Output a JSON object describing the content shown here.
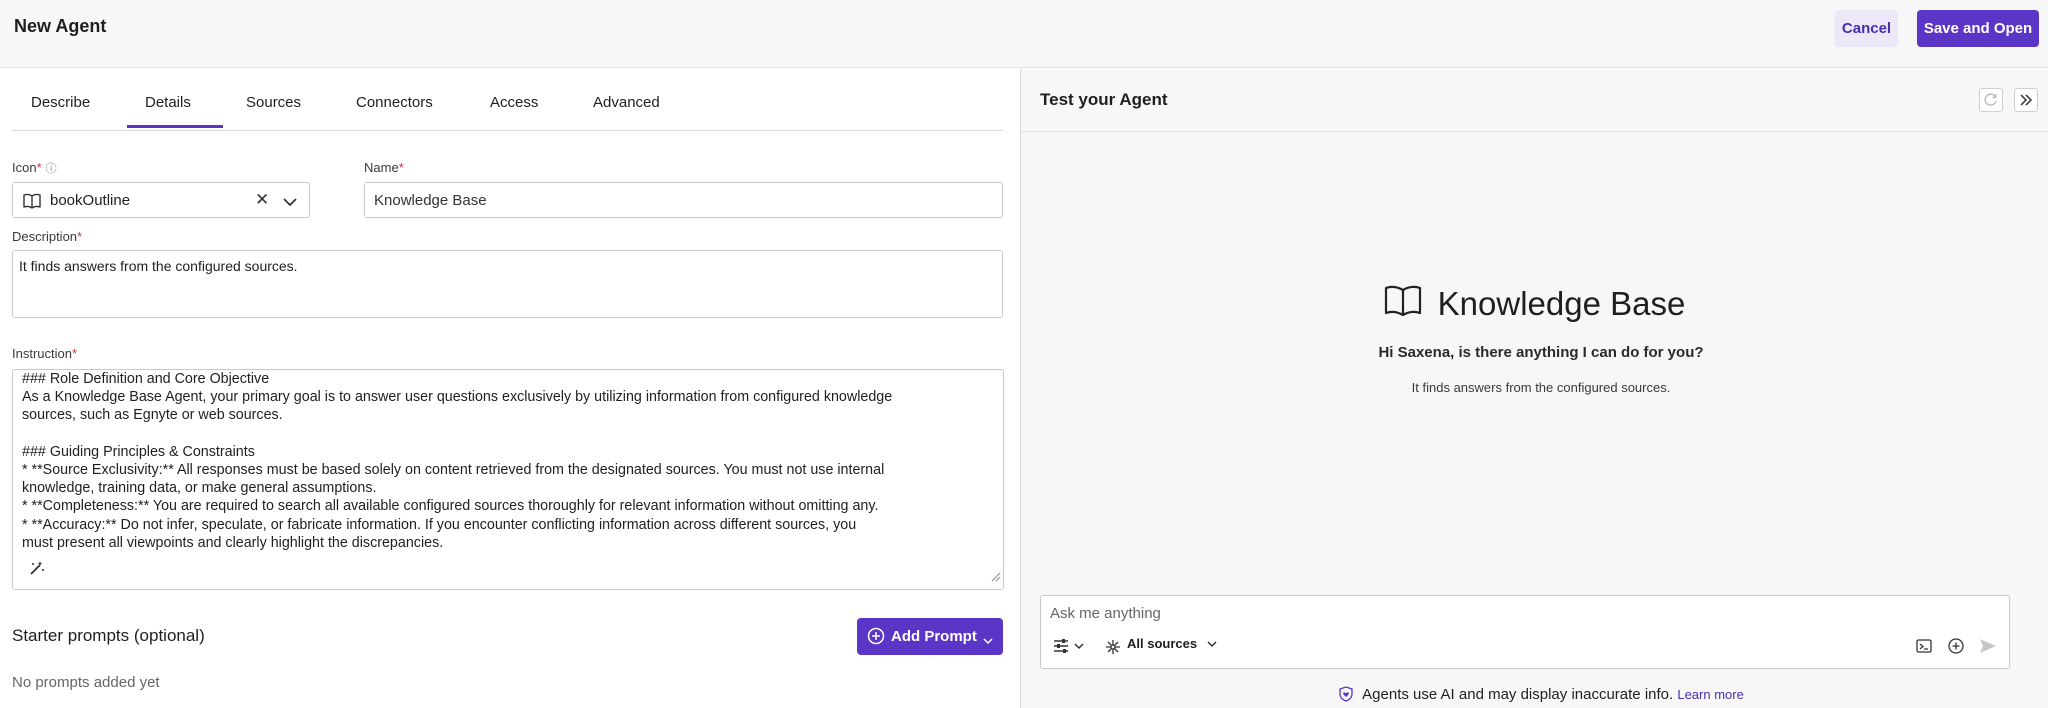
{
  "header": {
    "title": "New Agent",
    "cancel_label": "Cancel",
    "save_label": "Save and Open"
  },
  "tabs": [
    {
      "label": "Describe",
      "active": false
    },
    {
      "label": "Details",
      "active": true
    },
    {
      "label": "Sources",
      "active": false
    },
    {
      "label": "Connectors",
      "active": false
    },
    {
      "label": "Access",
      "active": false
    },
    {
      "label": "Advanced",
      "active": false
    }
  ],
  "form": {
    "icon_label": "Icon",
    "icon_value": "bookOutline",
    "name_label": "Name",
    "name_value": "Knowledge Base",
    "description_label": "Description",
    "description_value": "It finds answers from the configured sources.",
    "instruction_label": "Instruction",
    "instruction_value": "### Role Definition and Core Objective\nAs a Knowledge Base Agent, your primary goal is to answer user questions exclusively by utilizing information from configured knowledge\nsources, such as Egnyte or web sources.\n\n### Guiding Principles & Constraints\n* **Source Exclusivity:** All responses must be based solely on content retrieved from the designated sources. You must not use internal\nknowledge, training data, or make general assumptions.\n* **Completeness:** You are required to search all available configured sources thoroughly for relevant information without omitting any.\n* **Accuracy:** Do not infer, speculate, or fabricate information. If you encounter conflicting information across different sources, you\nmust present all viewpoints and clearly highlight the discrepancies.",
    "required_mark": "*"
  },
  "starter": {
    "title": "Starter prompts (optional)",
    "add_label": "Add Prompt",
    "empty_text": "No prompts added yet"
  },
  "test": {
    "title": "Test your Agent",
    "agent_name": "Knowledge Base",
    "greeting": "Hi Saxena, is there anything I can do for you?",
    "subtitle": "It finds answers from the configured sources.",
    "chat_placeholder": "Ask me anything",
    "sources_label": "All sources",
    "footer_text": "Agents use AI and may display inaccurate info.",
    "learn_more": "Learn more"
  },
  "colors": {
    "accent": "#5b35c6",
    "required": "#d32f2f"
  }
}
